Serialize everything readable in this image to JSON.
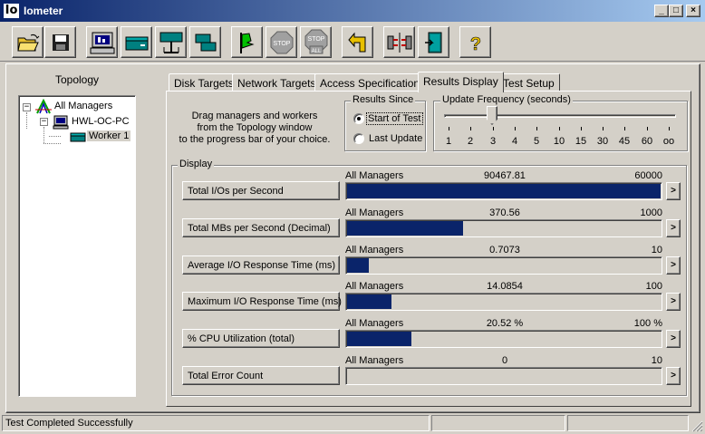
{
  "window": {
    "app_icon": "Io",
    "title": "Iometer",
    "minimize": "_",
    "maximize": "□",
    "close": "×"
  },
  "toolbar": [
    "open-config-icon",
    "save-config-icon",
    "show-results-icon",
    "new-disk-worker-icon",
    "new-network-worker-icon",
    "duplicate-worker-icon",
    "start-tests-icon",
    "stop-icon",
    "stop-all-icon",
    "reset-workers-icon",
    "disconnect-managers-icon",
    "exit-icon",
    "about-icon"
  ],
  "toolbar_labels": {
    "stop": "STOP",
    "stop_all_top": "STOP",
    "stop_all_bottom": "ALL",
    "about": "?"
  },
  "topology": {
    "label": "Topology",
    "all_managers": "All Managers",
    "manager": "HWL-OC-PC",
    "worker": "Worker 1",
    "exp_minus": "−"
  },
  "tabs": [
    "Disk Targets",
    "Network Targets",
    "Access Specifications",
    "Results Display",
    "Test Setup"
  ],
  "active_tab": "Results Display",
  "drag_text": [
    "Drag managers and workers",
    "from the Topology window",
    "to the progress bar of your choice."
  ],
  "results_since": {
    "title": "Results Since",
    "options": [
      "Start of Test",
      "Last Update"
    ],
    "selected": "Start of Test"
  },
  "update_frequency": {
    "title": "Update Frequency (seconds)",
    "ticks": [
      "1",
      "2",
      "3",
      "4",
      "5",
      "10",
      "15",
      "30",
      "45",
      "60",
      "oo"
    ],
    "selected": "3"
  },
  "display": {
    "title": "Display",
    "rows": [
      {
        "button": "Total I/Os per Second",
        "source": "All Managers",
        "value": "90467.81",
        "max": "60000",
        "fill": 1.0
      },
      {
        "button": "Total MBs per Second (Decimal)",
        "source": "All Managers",
        "value": "370.56",
        "max": "1000",
        "fill": 0.3706
      },
      {
        "button": "Average I/O Response Time (ms)",
        "source": "All Managers",
        "value": "0.7073",
        "max": "10",
        "fill": 0.0707
      },
      {
        "button": "Maximum I/O Response Time (ms)",
        "source": "All Managers",
        "value": "14.0854",
        "max": "100",
        "fill": 0.1409
      },
      {
        "button": "% CPU Utilization (total)",
        "source": "All Managers",
        "value": "20.52 %",
        "max": "100 %",
        "fill": 0.2052
      },
      {
        "button": "Total Error Count",
        "source": "All Managers",
        "value": "0",
        "max": "10",
        "fill": 0.0
      }
    ],
    "arrow": ">"
  },
  "status": {
    "text": "Test Completed Successfully",
    "panel2": "",
    "panel3": ""
  }
}
